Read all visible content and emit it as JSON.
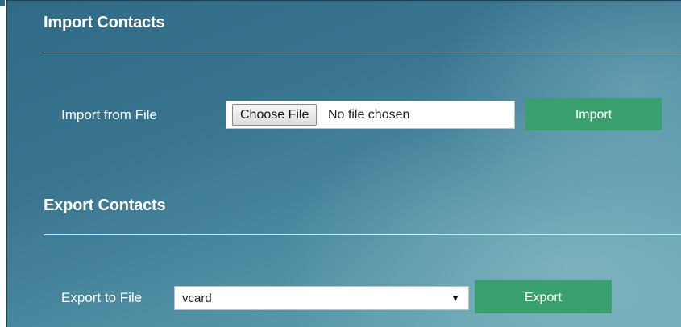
{
  "import_section": {
    "title": "Import Contacts",
    "field_label": "Import from File",
    "file_input": {
      "button_label": "Choose File",
      "status_text": "No file chosen"
    },
    "action_label": "Import"
  },
  "export_section": {
    "title": "Export Contacts",
    "field_label": "Export to File",
    "format_select": {
      "selected": "vcard",
      "arrow_icon": "triangle-down-icon"
    },
    "action_label": "Export"
  },
  "colors": {
    "button_green": "#3a9f6e",
    "panel_teal": "#3a7590",
    "text_white": "#ffffff"
  }
}
